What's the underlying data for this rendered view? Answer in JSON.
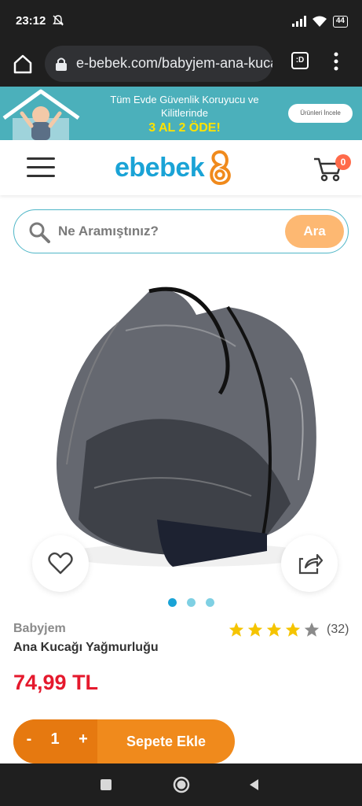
{
  "status": {
    "time": "23:12",
    "battery": "44"
  },
  "browser": {
    "url": "e-bebek.com/babyjem-ana-kucagi",
    "tab_label": ":D"
  },
  "promo": {
    "line1": "Tüm Evde Güvenlik Koruyucu ve Kilitlerinde",
    "line2": "3 AL 2 ÖDE!",
    "button": "Ürünleri İncele"
  },
  "header": {
    "logo": "ebebek",
    "cart_count": "0"
  },
  "search": {
    "placeholder": "Ne Aramıştınız?",
    "button": "Ara"
  },
  "product": {
    "brand": "Babyjem",
    "name": "Ana Kucağı Yağmurluğu",
    "rating": 4,
    "rating_max": 5,
    "review_count": "(32)",
    "price": "74,99 TL",
    "image_count": 3,
    "active_image": 1
  },
  "cart_bar": {
    "minus": "-",
    "quantity": "1",
    "plus": "+",
    "add_label": "Sepete Ekle"
  },
  "colors": {
    "accent_blue": "#1aa3d6",
    "accent_orange": "#f08a1c",
    "price_red": "#e5192d",
    "promo_teal": "#4bb0bb"
  },
  "icons": [
    "bell-off-icon",
    "signal-icon",
    "wifi-icon",
    "home-icon",
    "lock-icon",
    "menu-dots-icon",
    "hamburger-icon",
    "cart-icon",
    "search-icon",
    "heart-icon",
    "share-icon",
    "star-icon"
  ]
}
